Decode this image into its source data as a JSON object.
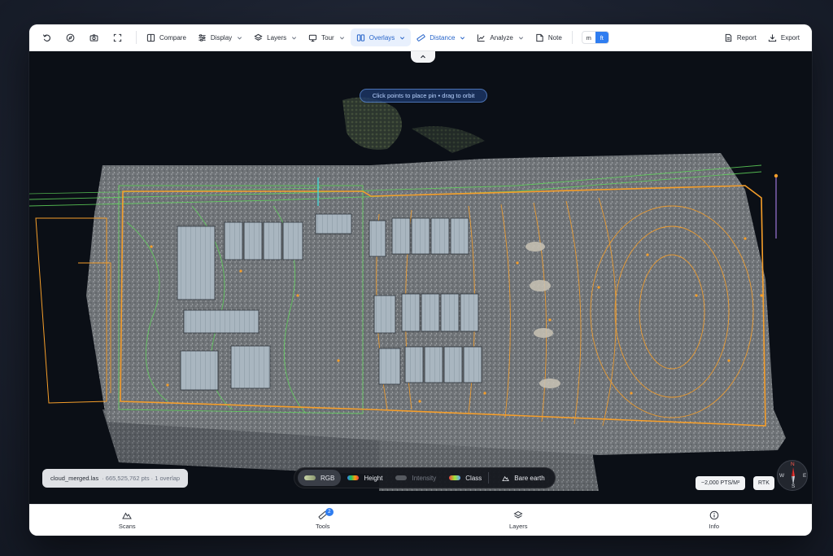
{
  "toolbar": {
    "icons": [
      "undo-icon",
      "compass-icon",
      "camera-icon",
      "fit-view-icon"
    ],
    "compare_label": "Compare",
    "display_label": "Display",
    "layers_label": "Layers",
    "tour_label": "Tour",
    "overlays_label": "Overlays",
    "distance_label": "Distance",
    "analyze_label": "Analyze",
    "note_label": "Note",
    "unit_m": "m",
    "unit_ft": "ft",
    "selected_unit": "ft",
    "report_label": "Report",
    "export_label": "Export"
  },
  "viewport": {
    "hint": "Click points to place pin • drag to orbit",
    "file_name": "cloud_merged.las",
    "file_meta": "· 665,525,762 pts · 1 overlap",
    "modes": [
      {
        "label": "RGB",
        "state": "active"
      },
      {
        "label": "Height",
        "state": "normal"
      },
      {
        "label": "Intensity",
        "state": "disabled"
      },
      {
        "label": "Class",
        "state": "normal"
      },
      {
        "label": "Bare earth",
        "state": "normal"
      }
    ],
    "density": "~2,000 PTS/M²",
    "rtk": "RTK",
    "compass": {
      "n": "N",
      "s": "S",
      "e": "E",
      "w": "W"
    }
  },
  "bottomnav": {
    "items": [
      {
        "label": "Scans",
        "icon": "mountain-icon"
      },
      {
        "label": "Tools",
        "icon": "ruler-icon",
        "badge": "2"
      },
      {
        "label": "Layers",
        "icon": "layers-icon"
      },
      {
        "label": "Info",
        "icon": "info-icon"
      }
    ]
  },
  "colors": {
    "accent": "#2f7df0",
    "contour_orange": "#f59e2a",
    "contour_green": "#5fd35a"
  }
}
